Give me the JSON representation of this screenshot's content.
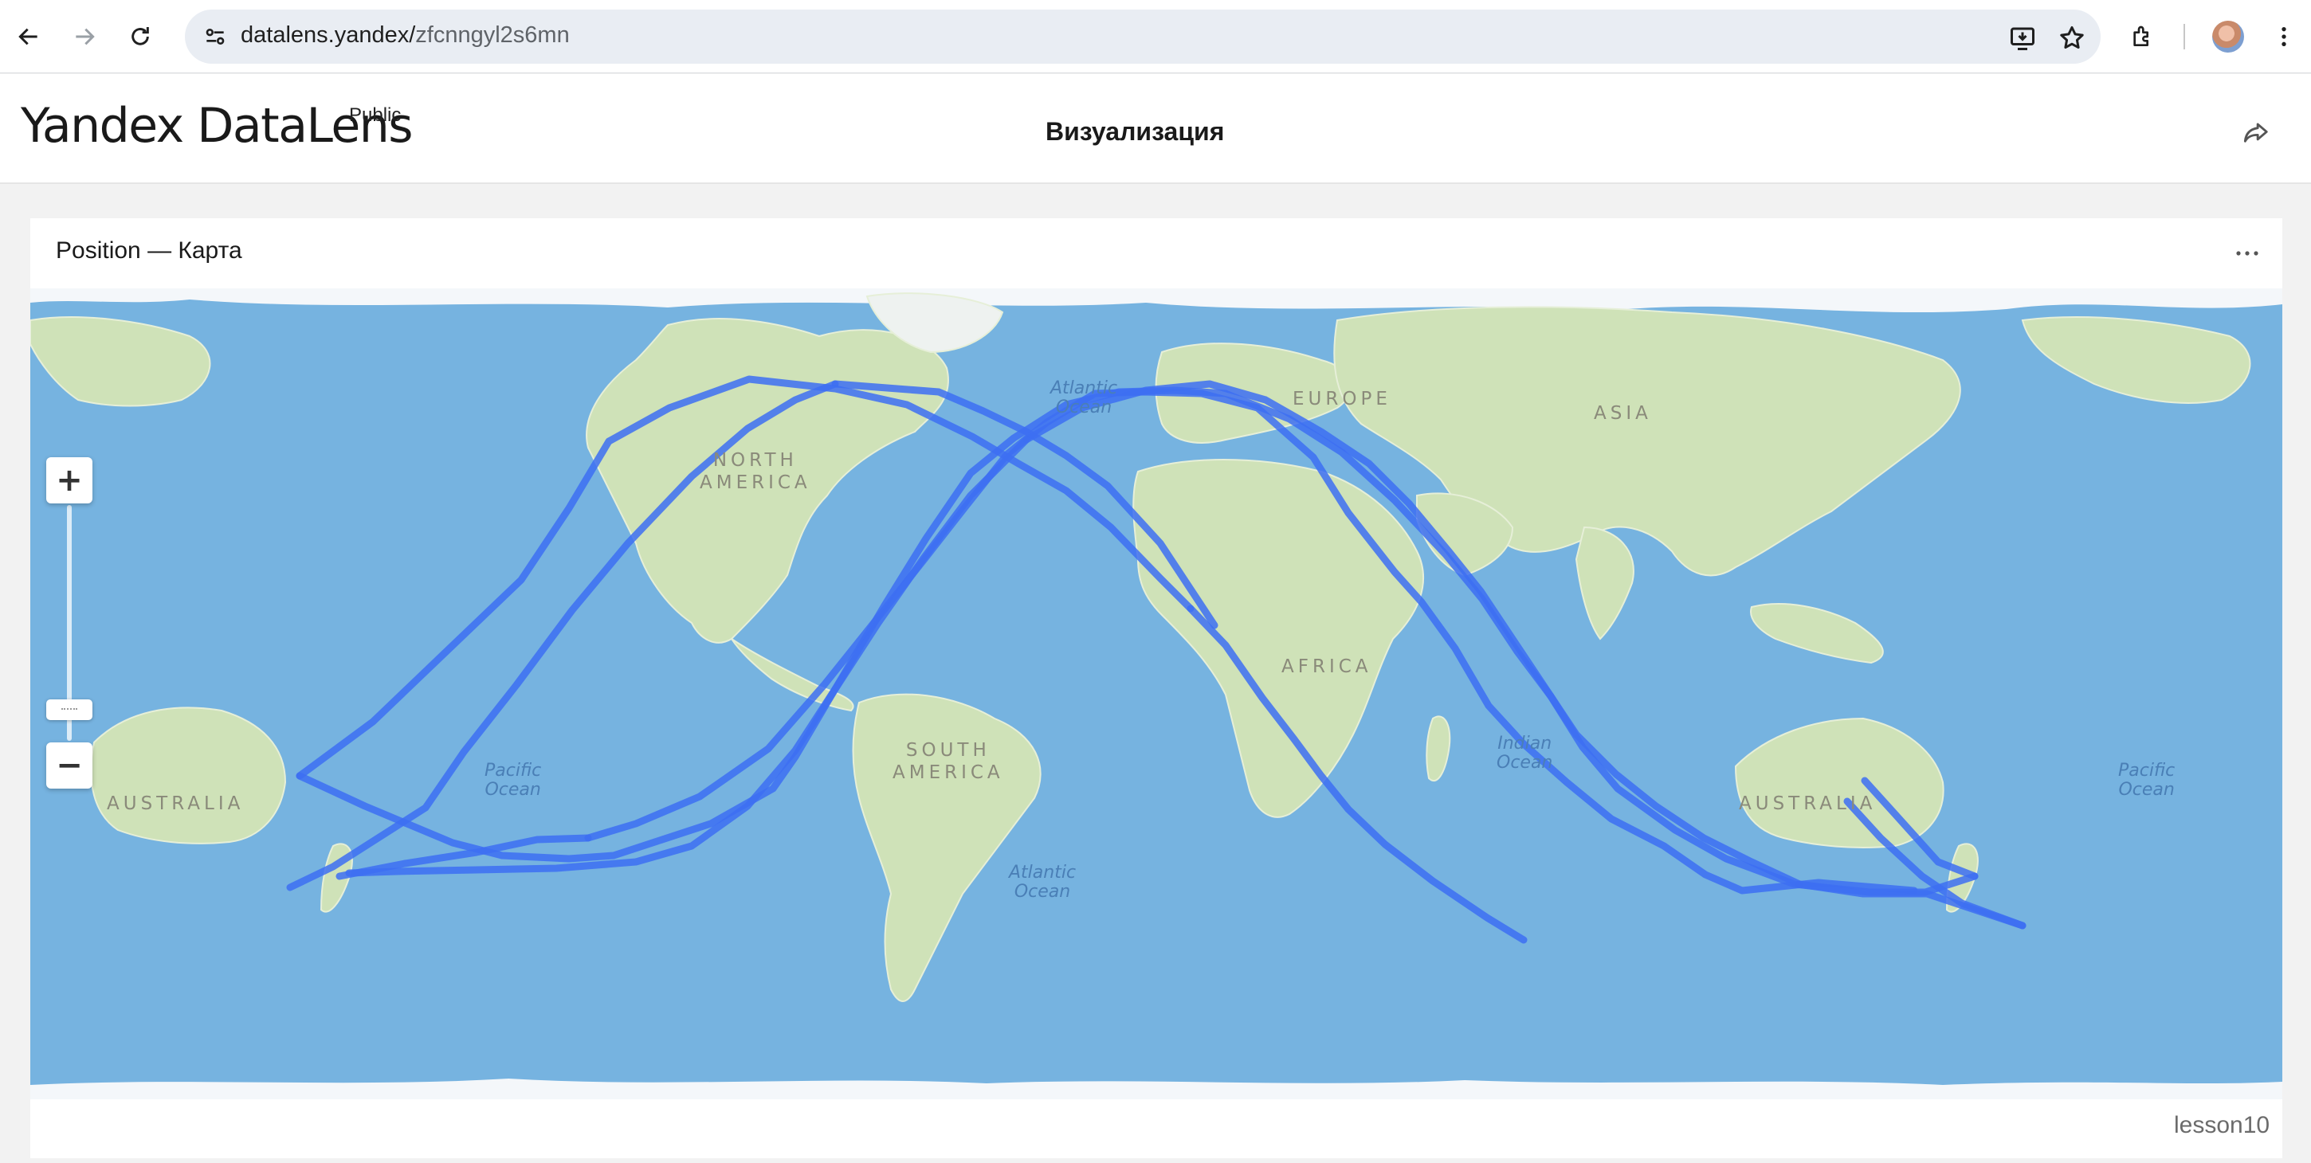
{
  "browser": {
    "url_host": "datalens.yandex/",
    "url_path": "zfcnngyl2s6mn"
  },
  "header": {
    "logo": "Yandex DataLens",
    "badge": "Public",
    "title": "Визуализация"
  },
  "widget": {
    "title": "Position — Карта",
    "footer": "lesson10",
    "map_labels": {
      "north_america": "NORTH\nAMERICA",
      "south_america": "SOUTH\nAMERICA",
      "europe": "EUROPE",
      "asia": "ASIA",
      "africa": "AFRICA",
      "australia_left": "AUSTRALIA",
      "australia_right": "AUSTRALIA",
      "atlantic_north": "Atlantic\nOcean",
      "atlantic_south": "Atlantic\nOcean",
      "pacific_left": "Pacific\nOcean",
      "pacific_right": "Pacific\nOcean",
      "indian": "Indian\nOcean"
    }
  },
  "colors": {
    "track": "#3d6ff2",
    "ocean": "#76b3e0",
    "land": "#cfe2b8"
  },
  "icons": [
    "back-arrow-icon",
    "forward-arrow-icon",
    "reload-icon",
    "site-settings-icon",
    "install-icon",
    "star-icon",
    "extensions-icon",
    "menu-dots-icon",
    "share-icon",
    "more-icon",
    "zoom-plus-icon",
    "zoom-minus-icon"
  ]
}
